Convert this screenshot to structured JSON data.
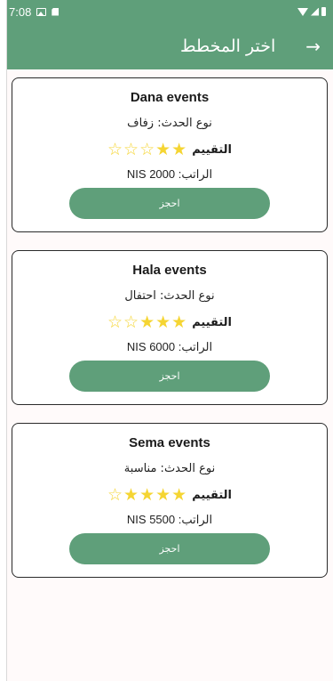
{
  "status_bar": {
    "time": "7:08",
    "icons": [
      "image-icon",
      "sd-card-icon",
      "wifi-icon",
      "signal-icon",
      "battery-icon"
    ]
  },
  "app_bar": {
    "title": "اختر المخطط",
    "back_icon": "arrow-right-icon",
    "back_glyph": "→"
  },
  "colors": {
    "primary": "#5f9f7a",
    "star": "#f5d533",
    "card_border": "#2a2a2a"
  },
  "event_type_prefix": "نوع الحدث:",
  "rating_label": "التقييم",
  "price_prefix": "الراتب:",
  "book_label": "احجز",
  "planners": [
    {
      "name": "Dana events",
      "event_type": "نوع الحدث: زفاف",
      "rating": 2,
      "max_rating": 5,
      "price": "الراتب: NIS 2000"
    },
    {
      "name": "Hala events",
      "event_type": "نوع الحدث: احتفال",
      "rating": 3,
      "max_rating": 5,
      "price": "الراتب: NIS 6000"
    },
    {
      "name": "Sema events",
      "event_type": "نوع الحدث: مناسبة",
      "rating": 4,
      "max_rating": 5,
      "price": "الراتب: NIS 5500"
    }
  ]
}
